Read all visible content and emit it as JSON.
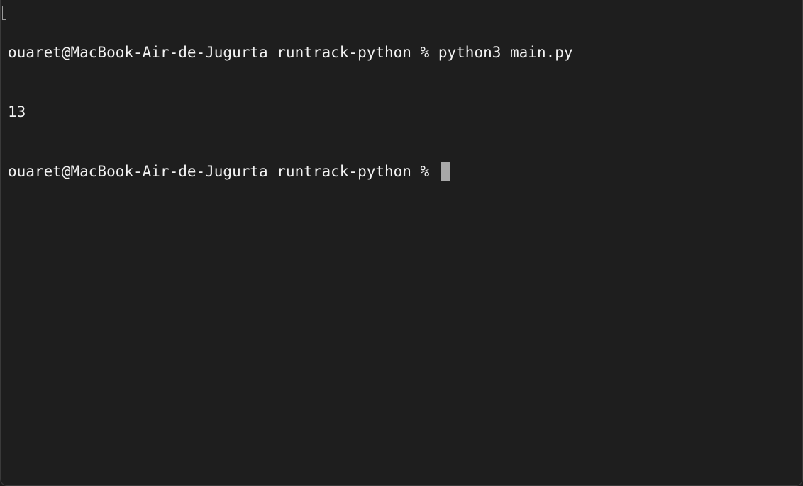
{
  "terminal": {
    "lines": [
      "ouaret@MacBook-Air-de-Jugurta runtrack-python % python3 main.py",
      "13",
      "ouaret@MacBook-Air-de-Jugurta runtrack-python % "
    ]
  },
  "colors": {
    "background": "#1e1e1e",
    "text": "#f2f2f2",
    "cursor": "#a8a8a8"
  }
}
